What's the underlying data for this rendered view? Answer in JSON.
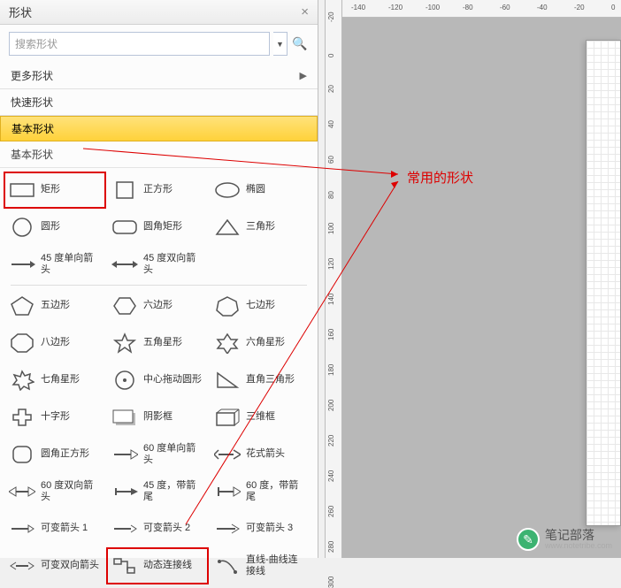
{
  "panel": {
    "title": "形状",
    "close": "×"
  },
  "search": {
    "placeholder": "搜索形状"
  },
  "sections": {
    "more": "更多形状",
    "quick": "快速形状",
    "basic": "基本形状"
  },
  "category": {
    "title": "基本形状"
  },
  "shapes": {
    "r1": [
      {
        "label": "矩形",
        "icon": "rect"
      },
      {
        "label": "正方形",
        "icon": "square"
      },
      {
        "label": "椭圆",
        "icon": "ellipse"
      }
    ],
    "r2": [
      {
        "label": "圆形",
        "icon": "circle"
      },
      {
        "label": "圆角矩形",
        "icon": "roundrect"
      },
      {
        "label": "三角形",
        "icon": "triangle"
      }
    ],
    "r3": [
      {
        "label": "45 度单向箭头",
        "icon": "arrow45"
      },
      {
        "label": "45 度双向箭头",
        "icon": "arrow45d"
      }
    ],
    "r4": [
      {
        "label": "五边形",
        "icon": "pentagon"
      },
      {
        "label": "六边形",
        "icon": "hexagon"
      },
      {
        "label": "七边形",
        "icon": "heptagon"
      }
    ],
    "r5": [
      {
        "label": "八边形",
        "icon": "octagon"
      },
      {
        "label": "五角星形",
        "icon": "star5"
      },
      {
        "label": "六角星形",
        "icon": "star6"
      }
    ],
    "r6": [
      {
        "label": "七角星形",
        "icon": "star7"
      },
      {
        "label": "中心拖动圆形",
        "icon": "dragcircle"
      },
      {
        "label": "直角三角形",
        "icon": "rtri"
      }
    ],
    "r7": [
      {
        "label": "十字形",
        "icon": "cross"
      },
      {
        "label": "阴影框",
        "icon": "shadowbox"
      },
      {
        "label": "三维框",
        "icon": "box3d"
      }
    ],
    "r8": [
      {
        "label": "圆角正方形",
        "icon": "roundsq"
      },
      {
        "label": "60 度单向箭头",
        "icon": "arrow60"
      },
      {
        "label": "花式箭头",
        "icon": "fancyarrow"
      }
    ],
    "r9": [
      {
        "label": "60 度双向箭头",
        "icon": "arrow60d"
      },
      {
        "label": "45 度，带箭尾",
        "icon": "arrow45t"
      },
      {
        "label": "60 度，带箭尾",
        "icon": "arrow60t"
      }
    ],
    "r10": [
      {
        "label": "可变箭头 1",
        "icon": "vararr1"
      },
      {
        "label": "可变箭头 2",
        "icon": "vararr2"
      },
      {
        "label": "可变箭头 3",
        "icon": "vararr3"
      }
    ],
    "r11": [
      {
        "label": "可变双向箭头",
        "icon": "vararrd"
      },
      {
        "label": "动态连接线",
        "icon": "dynconn"
      },
      {
        "label": "直线-曲线连接线",
        "icon": "lineconn"
      }
    ]
  },
  "annotation": {
    "text": "常用的形状"
  },
  "ruler_v": [
    "-20",
    "0",
    "20",
    "40",
    "60",
    "80",
    "100",
    "120",
    "140",
    "160",
    "180",
    "200",
    "220",
    "240",
    "260",
    "280",
    "300"
  ],
  "ruler_h": [
    "-140",
    "-120",
    "-100",
    "-80",
    "-60",
    "-40",
    "-20",
    "0"
  ],
  "watermark": {
    "title": "笔记部落",
    "sub": "www.notetribe.com"
  }
}
